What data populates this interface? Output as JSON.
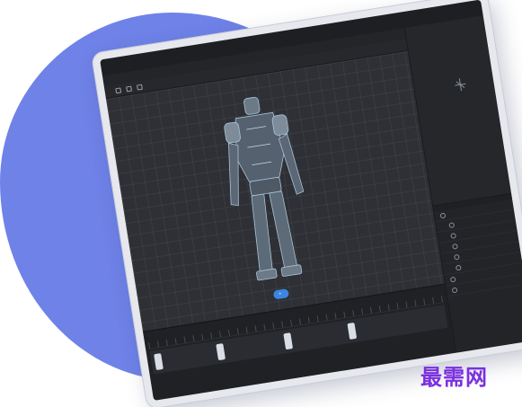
{
  "colors": {
    "background_blob": "#6f82e8",
    "watermark": "#7b2fe0",
    "accent": "#3a86e0"
  },
  "titlebar": {
    "tabs": [
      "",
      ""
    ],
    "right_buttons": [
      "",
      "",
      "",
      ""
    ]
  },
  "menubar": {
    "items": [
      "",
      ""
    ]
  },
  "toolbar": {
    "label": ""
  },
  "right_panel": {
    "hint": ""
  },
  "tree": {
    "tabs": [
      "",
      ""
    ],
    "rows": [
      "",
      "",
      "",
      "",
      "",
      "",
      "",
      ""
    ]
  },
  "viewport": {
    "add_button": ""
  },
  "timeline": {
    "labels": [
      "",
      "",
      ""
    ]
  },
  "icons": [
    "add-icon",
    "robot-model",
    "keyframe-icon"
  ],
  "watermark": "最需网"
}
